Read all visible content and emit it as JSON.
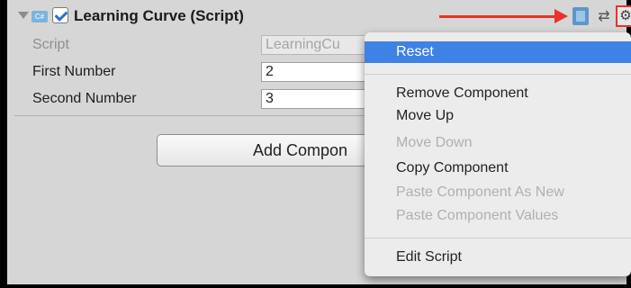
{
  "component": {
    "title": "Learning Curve (Script)",
    "enabled": true,
    "script_icon_text": "C#"
  },
  "properties": [
    {
      "label": "Script",
      "value": "LearningCu",
      "disabled": true
    },
    {
      "label": "First Number",
      "value": "2",
      "disabled": false
    },
    {
      "label": "Second Number",
      "value": "3",
      "disabled": false
    }
  ],
  "add_component_label": "Add Compon",
  "context_menu": {
    "items": [
      {
        "label": "Reset",
        "state": "highlighted"
      },
      {
        "label": "Remove Component",
        "state": "enabled"
      },
      {
        "label": "Move Up",
        "state": "enabled"
      },
      {
        "label": "Move Down",
        "state": "disabled"
      },
      {
        "label": "Copy Component",
        "state": "enabled"
      },
      {
        "label": "Paste Component As New",
        "state": "disabled"
      },
      {
        "label": "Paste Component Values",
        "state": "disabled"
      },
      {
        "label": "Edit Script",
        "state": "enabled"
      }
    ]
  },
  "icons": {
    "foldout": "foldout-arrow-icon",
    "script": "script-file-icon",
    "help": "help-book-icon",
    "presets": "presets-sliders-icon",
    "settings": "gear-icon",
    "annotation": "red-arrow"
  },
  "colors": {
    "annotation_red": "#e8322a",
    "highlight_blue": "#3f82e6",
    "checkbox_blue": "#2f6fcf"
  }
}
